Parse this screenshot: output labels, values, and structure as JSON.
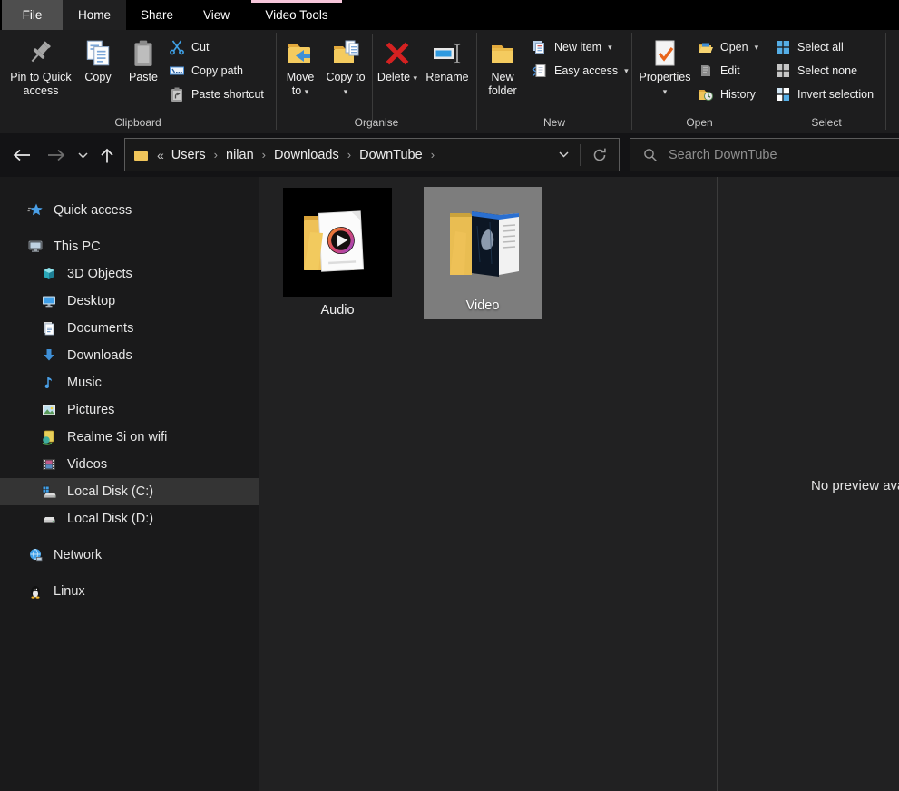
{
  "tabs": {
    "items": [
      {
        "label": "File"
      },
      {
        "label": "Home",
        "selected": true
      },
      {
        "label": "Share"
      },
      {
        "label": "View"
      },
      {
        "label": "Video Tools",
        "contextual": true
      }
    ]
  },
  "glyphs": {
    "caret": "▾"
  },
  "ribbon": {
    "groups": {
      "clipboard": {
        "label": "Clipboard",
        "pin_to_quick_access": "Pin to Quick access",
        "copy": "Copy",
        "paste": "Paste",
        "cut": "Cut",
        "copy_path": "Copy path",
        "paste_shortcut": "Paste shortcut"
      },
      "organise": {
        "label": "Organise",
        "move_to": "Move to",
        "copy_to": "Copy to",
        "delete": "Delete",
        "rename": "Rename"
      },
      "new": {
        "label": "New",
        "new_folder": "New folder",
        "new_item": "New item",
        "easy_access": "Easy access"
      },
      "open": {
        "label": "Open",
        "properties": "Properties",
        "open": "Open",
        "edit": "Edit",
        "history": "History"
      },
      "select": {
        "label": "Select",
        "select_all": "Select all",
        "select_none": "Select none",
        "invert_selection": "Invert selection"
      }
    }
  },
  "navigation": {
    "crumb_prefix": "«",
    "separator": "›",
    "crumbs": [
      "Users",
      "nilan",
      "Downloads",
      "DownTube"
    ]
  },
  "search": {
    "placeholder": "Search DownTube"
  },
  "sidebar": {
    "items": [
      {
        "label": "Quick access"
      },
      {
        "label": "This PC"
      },
      {
        "label": "3D Objects"
      },
      {
        "label": "Desktop"
      },
      {
        "label": "Documents"
      },
      {
        "label": "Downloads"
      },
      {
        "label": "Music"
      },
      {
        "label": "Pictures"
      },
      {
        "label": "Realme 3i on wifi"
      },
      {
        "label": "Videos"
      },
      {
        "label": "Local Disk (C:)",
        "selected": true
      },
      {
        "label": "Local Disk (D:)"
      },
      {
        "label": "Network"
      },
      {
        "label": "Linux"
      }
    ]
  },
  "files": {
    "items": [
      {
        "label": "Audio"
      },
      {
        "label": "Video",
        "selected": true
      }
    ]
  },
  "preview": {
    "message": "No preview available"
  },
  "colors": {
    "contextual_tab_accent": "#f6c6da",
    "selected_tile": "#7d7d7d",
    "sidebar_highlight": "#343434",
    "file_tab_bg": "#4e4e4e"
  }
}
